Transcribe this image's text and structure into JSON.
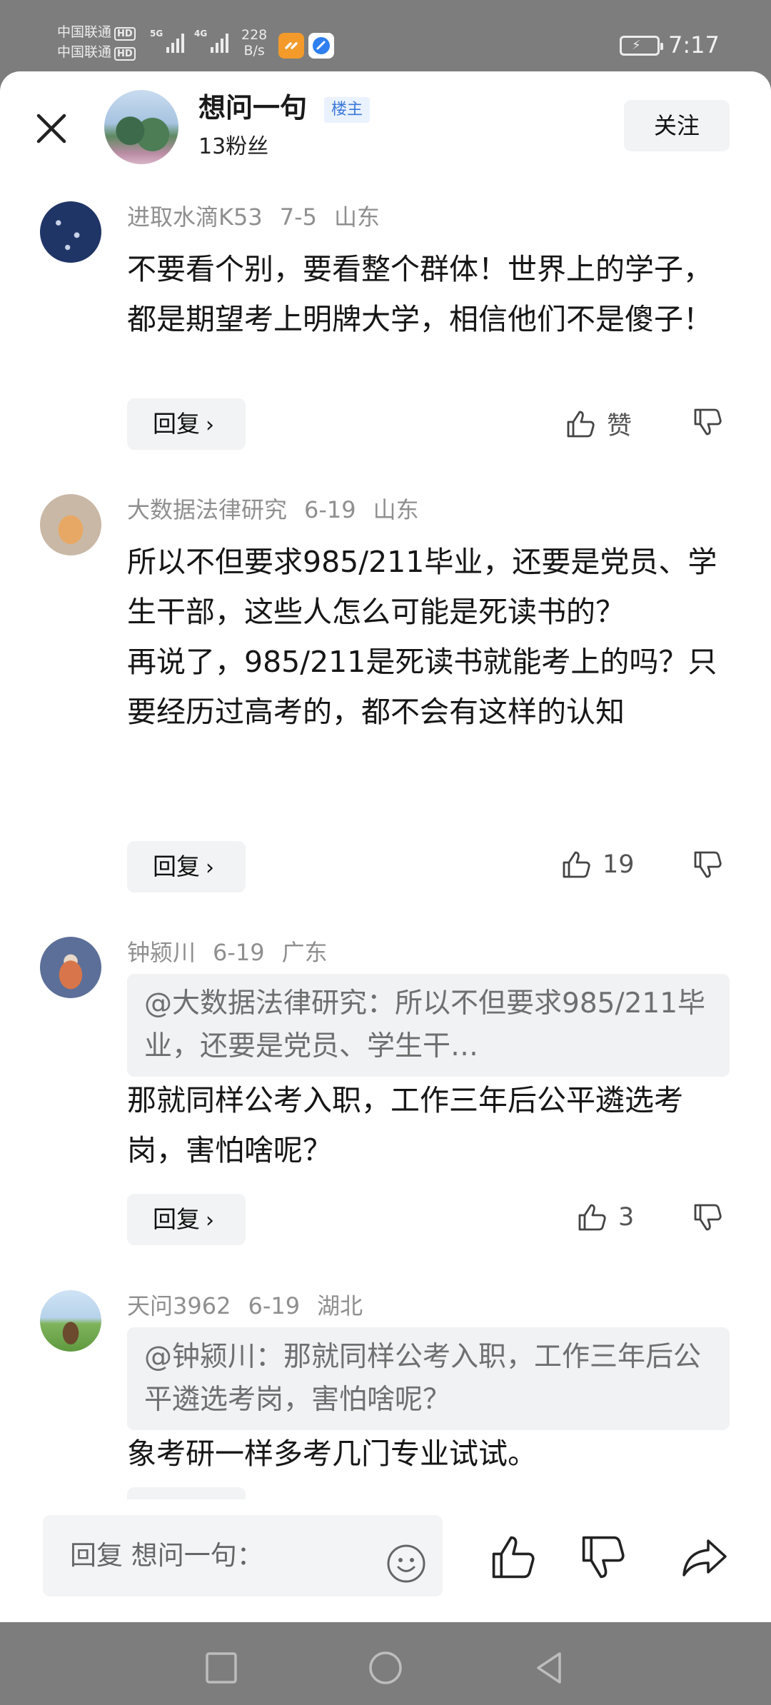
{
  "status_bar": {
    "carrier_1": "中国联通",
    "carrier_2": "中国联通",
    "hd": "HD",
    "network_1": "5G",
    "network_2": "4G",
    "net_speed_value": "228",
    "net_speed_unit": "B/s",
    "time": "7:17",
    "icons": [
      "signal-icon",
      "battery-charging-icon",
      "app-icon-orange",
      "app-icon-blue"
    ]
  },
  "header": {
    "close_icon": "close-icon",
    "name": "想问一句",
    "badge": "楼主",
    "fans": "13粉丝",
    "follow_label": "关注"
  },
  "comments": [
    {
      "author": "进取水滴K53",
      "date": "7-5",
      "location": "山东",
      "text": "不要看个别，要看整个群体！世界上的学子，都是期望考上明牌大学，相信他们不是傻子！",
      "quote": "",
      "reply_label": "回复",
      "like_label": "赞"
    },
    {
      "author": "大数据法律研究",
      "date": "6-19",
      "location": "山东",
      "text_1": "所以不但要求985/211毕业，还要是党员、学生干部，这些人怎么可能是死读书的？",
      "text_2": "再说了，985/211是死读书就能考上的吗？只要经历过高考的，都不会有这样的认知",
      "reply_label": "回复",
      "like_label": "19"
    },
    {
      "author": "钟颍川",
      "date": "6-19",
      "location": "广东",
      "quote": "@大数据法律研究：所以不但要求985/211毕业，还要是党员、学生干…",
      "text": "那就同样公考入职，工作三年后公平遴选考岗，害怕啥呢？",
      "reply_label": "回复",
      "like_label": "3"
    },
    {
      "author": "天问3962",
      "date": "6-19",
      "location": "湖北",
      "quote": "@钟颍川：那就同样公考入职，工作三年后公平遴选考岗，害怕啥呢？",
      "text": "象考研一样多考几门专业试试。"
    }
  ],
  "bottom_bar": {
    "reply_placeholder": "回复 想问一句：",
    "icons": [
      "emoji-icon",
      "thumbs-up-icon",
      "thumbs-down-icon",
      "share-icon"
    ]
  },
  "nav_bar": {
    "icons": [
      "recent-apps-icon",
      "home-icon",
      "back-icon"
    ]
  },
  "colors": {
    "accent_badge": "#3a78d6",
    "meta_gray": "#8f8f8f",
    "system_bar": "#7d7d7d"
  }
}
